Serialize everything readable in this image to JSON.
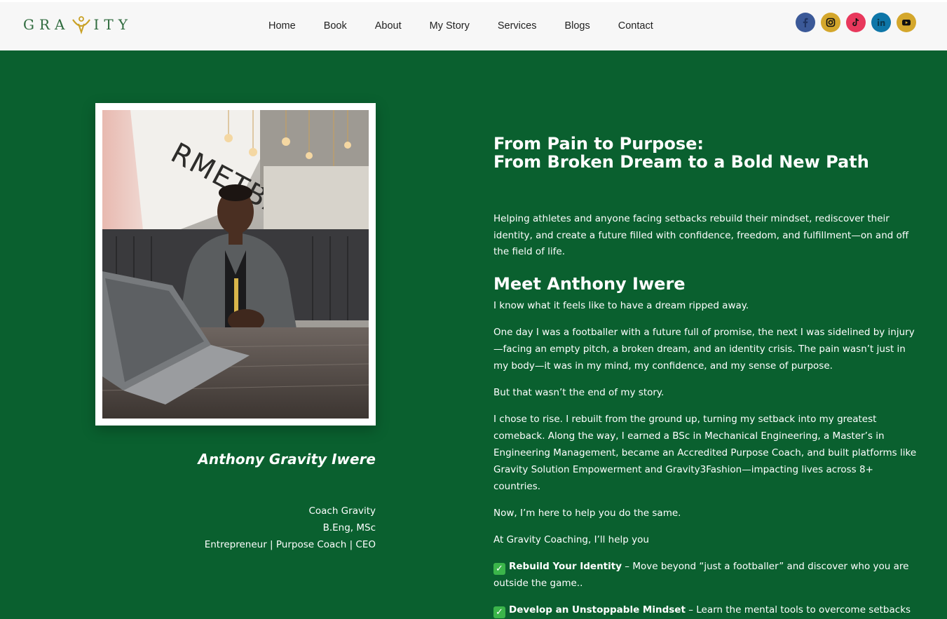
{
  "header": {
    "logo_text_left": "GRA",
    "logo_text_right": "ITY",
    "nav": [
      "Home",
      "Book",
      "About",
      "My Story",
      "Services",
      "Blogs",
      "Contact"
    ],
    "socials": [
      {
        "name": "facebook-icon",
        "color": "#3b5998"
      },
      {
        "name": "instagram-icon",
        "color": "#d4a72c"
      },
      {
        "name": "tiktok-icon",
        "color": "#e8385c"
      },
      {
        "name": "linkedin-icon",
        "color": "#0e76a8"
      },
      {
        "name": "youtube-icon",
        "color": "#d4a72c"
      }
    ]
  },
  "profile": {
    "name": "Anthony Gravity Iwere",
    "credentials": [
      "Coach Gravity",
      "B.Eng, MSc",
      "Entrepreneur | Purpose Coach | CEO"
    ]
  },
  "content": {
    "headline_line1": "From Pain to Purpose:",
    "headline_line2": "From Broken Dream to a Bold New Path",
    "intro": "Helping athletes and anyone facing setbacks rebuild their mindset, rediscover their identity, and create a future filled with confidence, freedom, and fulfillment—on and off the field of life.",
    "meet_heading": "Meet Anthony Iwere",
    "paragraphs": [
      "I know what it feels like to have a dream ripped away.",
      "One day I was a footballer with a future full of promise, the next I was sidelined by injury—facing an empty pitch, a broken dream, and an identity crisis. The pain wasn’t just in my body—it was in my mind, my confidence, and my sense of purpose.",
      "But that wasn’t the end of my story.",
      "I chose to rise. I rebuilt from the ground up, turning my setback into my greatest comeback. Along the way, I earned a BSc in Mechanical Engineering, a Master’s in Engineering Management, became an Accredited Purpose Coach, and built platforms like Gravity Solution Empowerment and Gravity3Fashion—impacting lives across 8+ countries.",
      "Now, I’m here to help you do the same.",
      "At Gravity Coaching, I’ll help you"
    ],
    "checklist": [
      {
        "bold": "Rebuild Your Identity",
        "text": " – Move beyond “just a footballer” and discover who you are outside the game.."
      },
      {
        "bold": "Develop an Unstoppable Mindset",
        "text": " – Learn the mental tools to overcome setbacks and embrace growth."
      }
    ]
  }
}
